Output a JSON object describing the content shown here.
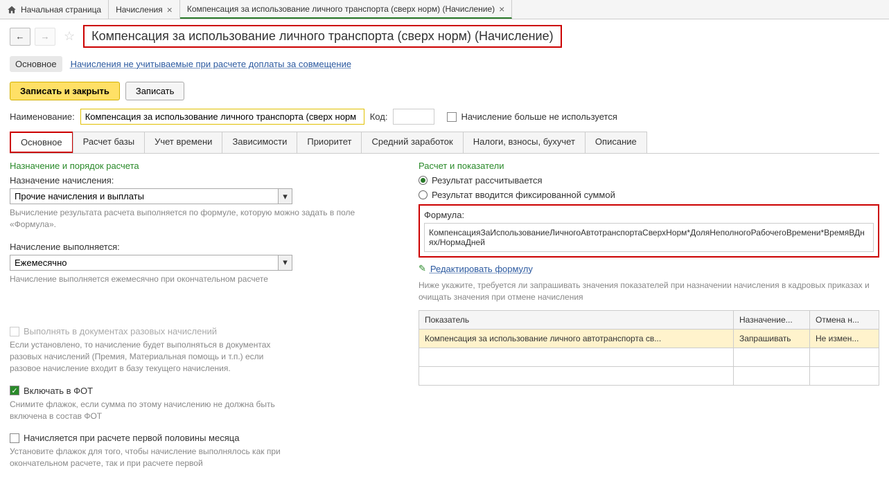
{
  "tabs": {
    "home": "Начальная страница",
    "accruals": "Начисления",
    "current": "Компенсация за использование личного транспорта (сверх норм) (Начисление)"
  },
  "title": "Компенсация за использование личного транспорта (сверх норм) (Начисление)",
  "subnav": {
    "main": "Основное",
    "link": "Начисления не учитываемые при расчете доплаты за совмещение"
  },
  "actions": {
    "save_close": "Записать и закрыть",
    "save": "Записать"
  },
  "form": {
    "name_label": "Наименование:",
    "name_value": "Компенсация за использование личного транспорта (сверх норм",
    "code_label": "Код:",
    "code_value": "",
    "not_used_label": "Начисление больше не используется"
  },
  "main_tabs": [
    "Основное",
    "Расчет базы",
    "Учет времени",
    "Зависимости",
    "Приоритет",
    "Средний заработок",
    "Налоги, взносы, бухучет",
    "Описание"
  ],
  "left": {
    "section1": "Назначение и порядок расчета",
    "purpose_label": "Назначение начисления:",
    "purpose_value": "Прочие начисления и выплаты",
    "purpose_hint": "Вычисление результата расчета выполняется по формуле, которую можно задать в поле «Формула».",
    "when_label": "Начисление выполняется:",
    "when_value": "Ежемесячно",
    "when_hint": "Начисление выполняется ежемесячно при окончательном расчете",
    "cb1_label": "Выполнять в документах разовых начислений",
    "cb1_hint": "Если установлено, то начисление будет выполняться в документах разовых начислений (Премия, Материальная помощь и т.п.) если разовое начисление входит в базу текущего начисления.",
    "cb2_label": "Включать в ФОТ",
    "cb2_hint": "Снимите флажок, если сумма по этому начислению не должна быть включена в состав ФОТ",
    "cb3_label": "Начисляется при расчете первой половины месяца",
    "cb3_hint": "Установите флажок для того, чтобы начисление выполнялось как при окончательном расчете, так и при расчете первой"
  },
  "right": {
    "section": "Расчет и показатели",
    "radio1": "Результат рассчитывается",
    "radio2": "Результат вводится фиксированной суммой",
    "formula_label": "Формула:",
    "formula_value": "КомпенсацияЗаИспользованиеЛичногоАвтотранспортаСверхНорм*ДоляНеполногоРабочегоВремени*ВремяВДнях/НормаДней",
    "edit_link": "Редактировать формулу",
    "ind_hint": "Ниже укажите, требуется ли запрашивать значения показателей при назначении начисления в кадровых приказах и очищать значения при отмене начисления",
    "th1": "Показатель",
    "th2": "Назначение...",
    "th3": "Отмена н...",
    "td1": "Компенсация за использование личного автотранспорта св...",
    "td2": "Запрашивать",
    "td3": "Не измен..."
  }
}
